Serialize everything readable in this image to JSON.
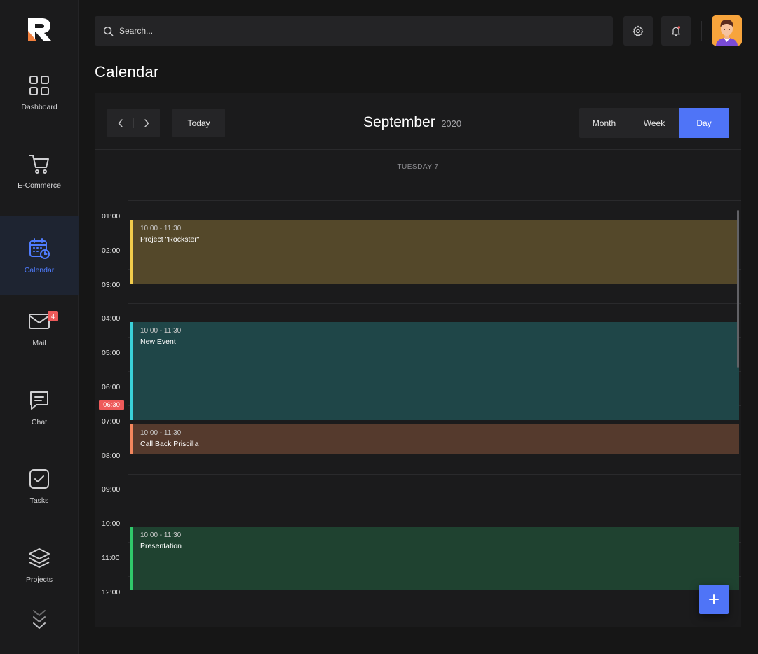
{
  "sidebar": {
    "items": [
      {
        "label": "Dashboard",
        "icon": "grid-icon"
      },
      {
        "label": "E-Commerce",
        "icon": "cart-icon"
      },
      {
        "label": "Calendar",
        "icon": "calendar-icon",
        "active": true
      },
      {
        "label": "Mail",
        "icon": "mail-icon",
        "badge": "4"
      },
      {
        "label": "Chat",
        "icon": "chat-icon"
      },
      {
        "label": "Tasks",
        "icon": "checkbox-icon"
      },
      {
        "label": "Projects",
        "icon": "layers-icon"
      }
    ]
  },
  "header": {
    "search_placeholder": "Search..."
  },
  "page": {
    "title": "Calendar"
  },
  "calendar": {
    "today_label": "Today",
    "month": "September",
    "year": "2020",
    "views": [
      "Month",
      "Week",
      "Day"
    ],
    "active_view": "Day",
    "day_label": "TUESDAY 7",
    "hours": [
      "01:00",
      "02:00",
      "03:00",
      "04:00",
      "05:00",
      "06:00",
      "07:00",
      "08:00",
      "09:00",
      "10:00",
      "11:00",
      "12:00"
    ],
    "current_time": "06:30",
    "events": [
      {
        "time": "10:00 - 11:30",
        "title": "Project \"Rockster\"",
        "accent": "#f2cc4b",
        "bg": "#54482a"
      },
      {
        "time": "10:00 - 11:30",
        "title": "New Event",
        "accent": "#3ad1d9",
        "bg": "#1f4648"
      },
      {
        "time": "10:00 - 11:30",
        "title": "Call Back Priscilla",
        "accent": "#f3865d",
        "bg": "#553a2d"
      },
      {
        "time": "10:00 - 11:30",
        "title": "Presentation",
        "accent": "#2fc96a",
        "bg": "#1f4230"
      }
    ]
  },
  "colors": {
    "accent": "#4f74f7",
    "danger": "#ee5a5a"
  }
}
